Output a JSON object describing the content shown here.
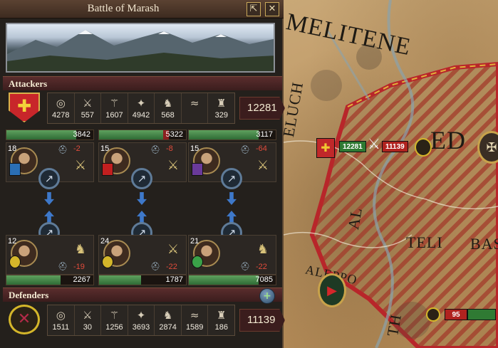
{
  "window": {
    "title": "Battle of Marash",
    "btn_options": "⇱",
    "btn_close": "✕"
  },
  "attackers": {
    "label": "Attackers",
    "total": "12281",
    "troops": [
      {
        "icon": "light-infantry-icon",
        "glyph": "◎",
        "count": "4278"
      },
      {
        "icon": "heavy-infantry-icon",
        "glyph": "⚔",
        "count": "557"
      },
      {
        "icon": "pikemen-icon",
        "glyph": "⚚",
        "count": "1607"
      },
      {
        "icon": "archers-icon",
        "glyph": "✦",
        "count": "4942"
      },
      {
        "icon": "light-cavalry-icon",
        "glyph": "♞",
        "count": "568"
      },
      {
        "icon": "horse-archers-icon",
        "glyph": "≈",
        "count": ""
      },
      {
        "icon": "knights-icon",
        "glyph": "♜",
        "count": "329"
      }
    ],
    "flanks": [
      {
        "morale": "3842",
        "skill": "18",
        "modifier": "-2"
      },
      {
        "morale": "5322",
        "skill": "15",
        "modifier": "-8"
      },
      {
        "morale": "3117",
        "skill": "15",
        "modifier": "-64"
      }
    ]
  },
  "defenders": {
    "label": "Defenders",
    "total": "11139",
    "troops": [
      {
        "icon": "light-infantry-icon",
        "glyph": "◎",
        "count": "1511"
      },
      {
        "icon": "heavy-infantry-icon",
        "glyph": "⚔",
        "count": "30"
      },
      {
        "icon": "pikemen-icon",
        "glyph": "⚚",
        "count": "1256"
      },
      {
        "icon": "archers-icon",
        "glyph": "✦",
        "count": "3693"
      },
      {
        "icon": "light-cavalry-icon",
        "glyph": "♞",
        "count": "2874"
      },
      {
        "icon": "horse-archers-icon",
        "glyph": "≈",
        "count": "1589"
      },
      {
        "icon": "knights-icon",
        "glyph": "♜",
        "count": "186"
      }
    ],
    "flanks": [
      {
        "morale": "2267",
        "skill": "12",
        "modifier": "-19"
      },
      {
        "morale": "1787",
        "skill": "24",
        "modifier": "-22"
      },
      {
        "morale": "7085",
        "skill": "21",
        "modifier": "-22"
      }
    ]
  },
  "map": {
    "labels": {
      "melitene": "MELITENE",
      "eluch": "ELUCH",
      "ed": "ED",
      "aleppo": "ALEPPO",
      "teli": "TELI",
      "bas": "BAS",
      "al": "AL",
      "th": "TH"
    },
    "battle_attacker": "12281",
    "battle_defender": "11139",
    "enemy_army": "95"
  },
  "colors": {
    "attacker_red": "#c0282a",
    "defender_yellow": "#d4b62a",
    "morale_green": "#3f8a44",
    "accent_gold": "#c9a85a"
  }
}
